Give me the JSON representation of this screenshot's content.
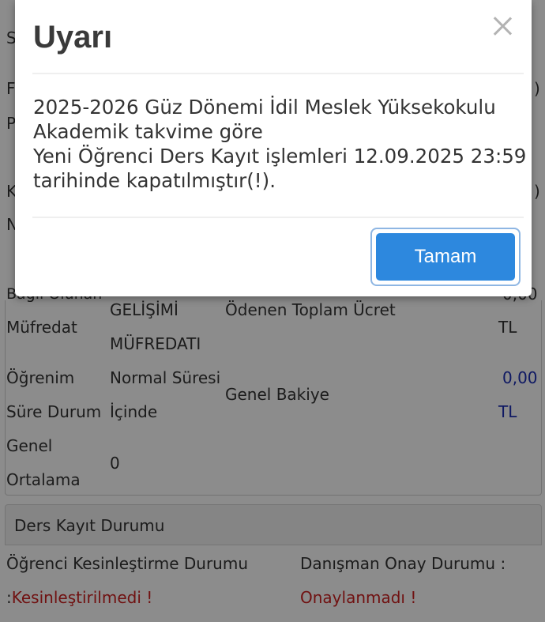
{
  "modal": {
    "title": "Uyarı",
    "message_lines": [
      "2025-2026 Güz Dönemi İdil Meslek Yüksekokulu",
      "Akademik takvime göre",
      "Yeni Öğrenci Ders Kayıt işlemleri 12.09.2025 23:59",
      "tarihinde kapatılmıştır(!)."
    ],
    "ok_label": "Tamam"
  },
  "background": {
    "partial_left_letters": [
      "S",
      "F",
      "P",
      "K",
      "N"
    ],
    "right_paren": ")",
    "row_partial_label": "Bağlı Olunan",
    "row_partial_value": "0,00",
    "mufredat_label": "Müfredat",
    "mufredat_value_lines": [
      "GELİŞİMİ",
      "MÜFREDATI"
    ],
    "odenen_label": "Ödenen Toplam Ücret",
    "odenen_currency": "TL",
    "ogrenim_label_lines": [
      "Öğrenim",
      "Süre Durum"
    ],
    "ogrenim_value_lines": [
      "Normal Süresi",
      "İçinde"
    ],
    "genel_bakiye_label": "Genel Bakiye",
    "genel_bakiye_value": "0,00",
    "genel_bakiye_currency": "TL",
    "genel_ortalama_lines": [
      "Genel",
      "Ortalama"
    ],
    "genel_ortalama_value": "0",
    "ders_kayit_title": "Ders Kayıt Durumu",
    "kesinlestirme_label": "Öğrenci Kesinleştirme Durumu",
    "kesinlestirme_prefix": ":",
    "kesinlestirme_value": "Kesinleştirilmedi !",
    "danisman_label": "Danışman Onay Durumu :",
    "danisman_value": "Onaylanmadı !"
  }
}
